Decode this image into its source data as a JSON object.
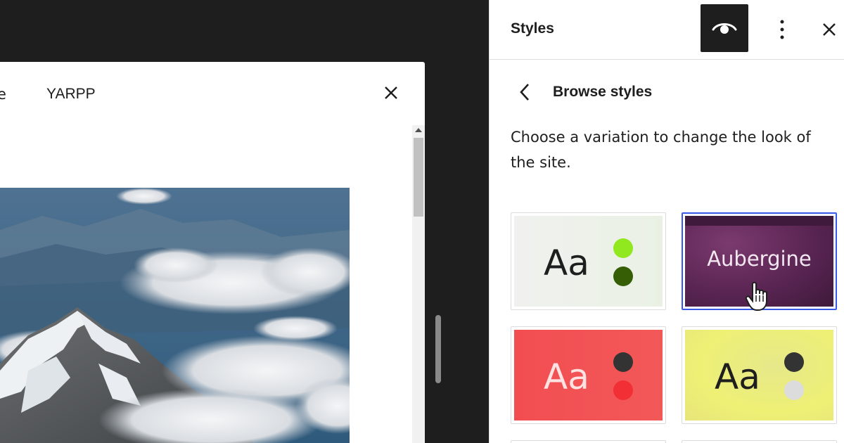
{
  "modal": {
    "tab_prev_partial": "e",
    "tab_yarpp": "YARPP"
  },
  "sidebar": {
    "title": "Styles",
    "browse_title": "Browse styles",
    "description": "Choose a variation to change the look of the site.",
    "icons": {
      "preview": "eye-icon",
      "more": "more-vertical-icon",
      "close": "close-icon",
      "back": "chevron-left-icon"
    }
  },
  "variations": [
    {
      "name": "default",
      "sample": "Aa",
      "text_color": "#1e1e1e",
      "dots": [
        "#91e81f",
        "#355e05"
      ],
      "bg": "#eef1ea"
    },
    {
      "name": "aubergine",
      "label": "Aubergine",
      "text_color": "#f3e8f1",
      "bg": "#5a2553",
      "selected": true
    },
    {
      "name": "red",
      "sample": "Aa",
      "text_color": "#ffe2e2",
      "dots": [
        "#333333",
        "#f22f34"
      ],
      "bg": "#f24e52"
    },
    {
      "name": "yellow",
      "sample": "Aa",
      "text_color": "#1e1e1e",
      "dots": [
        "#333333",
        "#dcdcdc"
      ],
      "bg": "#e8ea80"
    }
  ],
  "colors": {
    "accent": "#3858e9",
    "dark": "#1e1e1e"
  }
}
